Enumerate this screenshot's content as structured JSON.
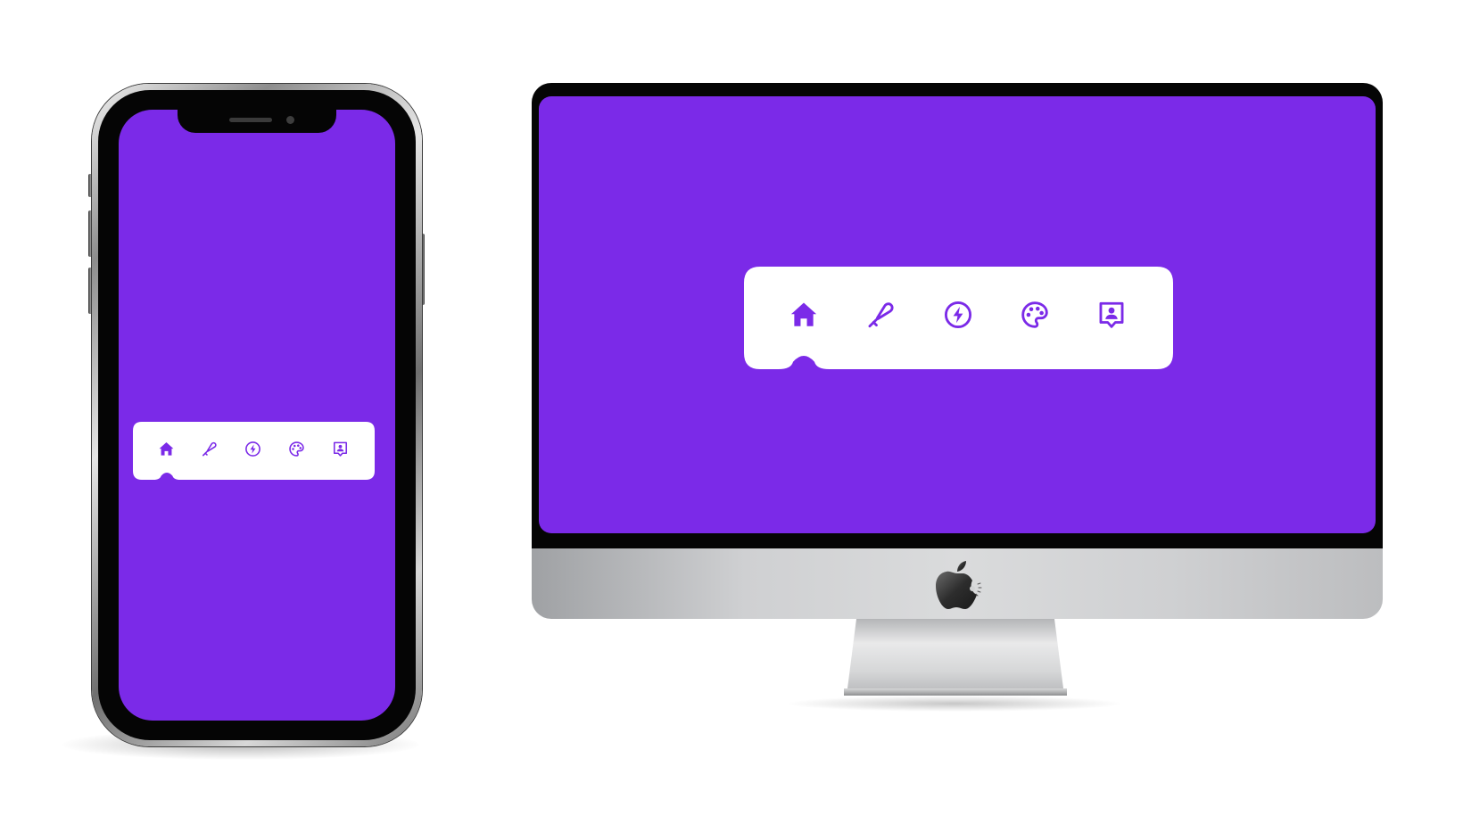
{
  "theme": {
    "screen_color": "#7b2ae8",
    "navbar_color": "#ffffff",
    "icon_color": "#7b2ae8"
  },
  "devices": {
    "phone": {
      "name": "phone"
    },
    "monitor": {
      "name": "desktop-monitor",
      "logo_icon": "apple-logo-icon"
    }
  },
  "navbar": {
    "active_index": 0,
    "items": [
      {
        "label": "Home",
        "icon": "home-icon"
      },
      {
        "label": "Ice cream",
        "icon": "popsicle-icon"
      },
      {
        "label": "Flash",
        "icon": "lightning-circle-icon"
      },
      {
        "label": "Palette",
        "icon": "palette-icon"
      },
      {
        "label": "Contact",
        "icon": "contact-card-icon"
      }
    ]
  }
}
